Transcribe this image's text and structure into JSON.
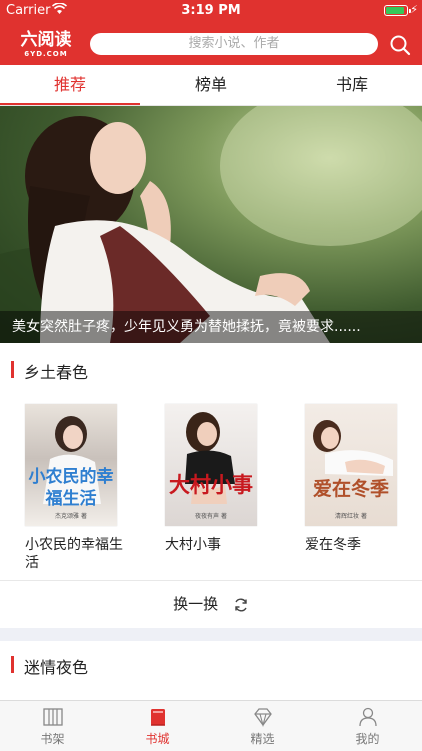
{
  "status_bar": {
    "carrier": "Carrier",
    "time": "3:19 PM",
    "battery_level": 0.9
  },
  "header": {
    "logo_text": "六阅读",
    "logo_subtext": "6YD.COM",
    "search_placeholder": "搜索小说、作者"
  },
  "tabs": [
    {
      "label": "推荐",
      "active": true
    },
    {
      "label": "榜单",
      "active": false
    },
    {
      "label": "书库",
      "active": false
    }
  ],
  "banner": {
    "caption": "美女突然肚子疼，少年见义勇为替她揉抚，竟被要求......"
  },
  "sections": [
    {
      "title": "乡土春色",
      "books": [
        {
          "name": "小农民的幸福生活",
          "cover_title": "小农民的幸福生活",
          "cover_author": "杰克颂雅 著",
          "cover_color": "#2f7fd0"
        },
        {
          "name": "大村小事",
          "cover_title": "大村小事",
          "cover_author": "夜夜有声 著",
          "cover_color": "#c8191f"
        },
        {
          "name": "爱在冬季",
          "cover_title": "爱在冬季",
          "cover_author": "清辉红妆 著",
          "cover_color": "#b0502a"
        }
      ],
      "refresh_label": "换一换"
    },
    {
      "title": "迷情夜色"
    }
  ],
  "bottom_nav": [
    {
      "label": "书架",
      "icon": "bookshelf-icon",
      "active": false
    },
    {
      "label": "书城",
      "icon": "bookstore-icon",
      "active": true
    },
    {
      "label": "精选",
      "icon": "diamond-icon",
      "active": false
    },
    {
      "label": "我的",
      "icon": "user-icon",
      "active": false
    }
  ],
  "colors": {
    "accent": "#e0322f",
    "tab_text": "#222222",
    "nav_inactive": "#777777"
  }
}
